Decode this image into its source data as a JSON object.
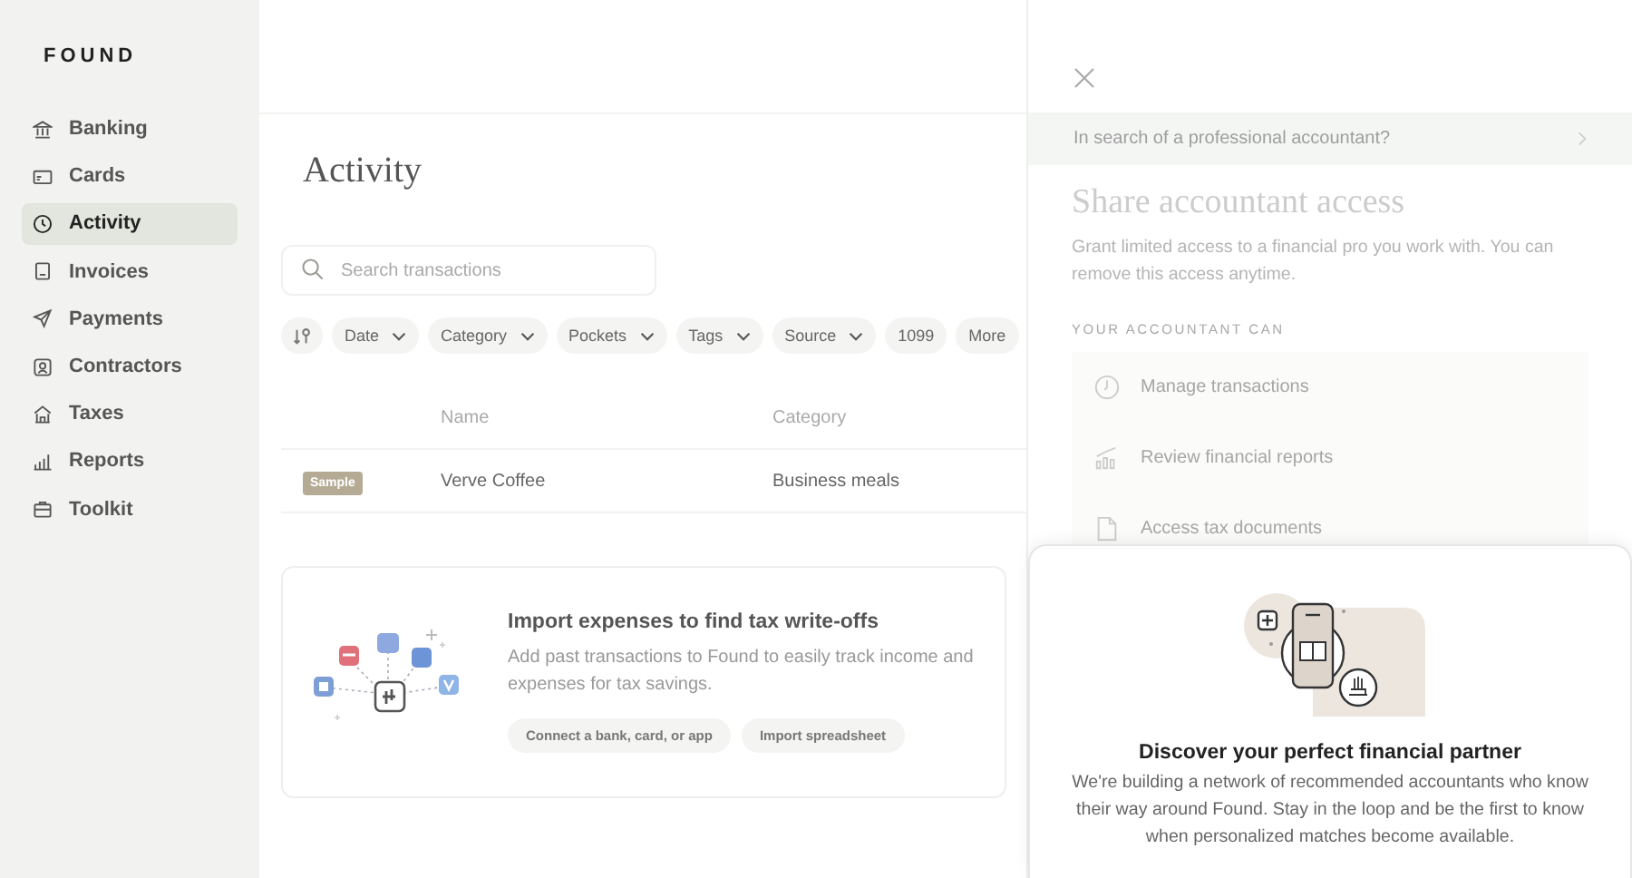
{
  "brand": "FOUND",
  "sidebar": {
    "items": [
      {
        "label": "Banking",
        "selected": false
      },
      {
        "label": "Cards",
        "selected": false
      },
      {
        "label": "Activity",
        "selected": true
      },
      {
        "label": "Invoices",
        "selected": false
      },
      {
        "label": "Payments",
        "selected": false
      },
      {
        "label": "Contractors",
        "selected": false
      },
      {
        "label": "Taxes",
        "selected": false
      },
      {
        "label": "Reports",
        "selected": false
      },
      {
        "label": "Toolkit",
        "selected": false
      }
    ]
  },
  "main": {
    "title": "Activity",
    "search": {
      "placeholder": "Search transactions"
    },
    "filters": [
      {
        "label": "Date",
        "dropdown": true
      },
      {
        "label": "Category",
        "dropdown": true
      },
      {
        "label": "Pockets",
        "dropdown": true
      },
      {
        "label": "Tags",
        "dropdown": true
      },
      {
        "label": "Source",
        "dropdown": true
      },
      {
        "label": "1099",
        "dropdown": false
      },
      {
        "label": "More",
        "dropdown": false
      }
    ],
    "table": {
      "columns": [
        "Name",
        "Category"
      ],
      "rows": [
        {
          "badge": "Sample",
          "name": "Verve Coffee",
          "category": "Business meals"
        }
      ]
    },
    "import_card": {
      "title": "Import expenses to find tax write-offs",
      "text": "Add past transactions to Found to easily track income and expenses for tax savings.",
      "buttons": [
        "Connect a bank, card, or app",
        "Import spreadsheet"
      ]
    }
  },
  "drawer": {
    "banner": "In search of a professional accountant?",
    "title": "Share accountant access",
    "description": "Grant limited access to a financial pro you work with. You can remove this access anytime.",
    "section_label": "YOUR ACCOUNTANT CAN",
    "permissions": [
      "Manage transactions",
      "Review financial reports",
      "Access tax documents"
    ]
  },
  "popup": {
    "title": "Discover your perfect financial partner",
    "text": "We're building a network of recommended accountants who know their way around Found. Stay in the loop and be the first to know when personalized matches become available."
  }
}
